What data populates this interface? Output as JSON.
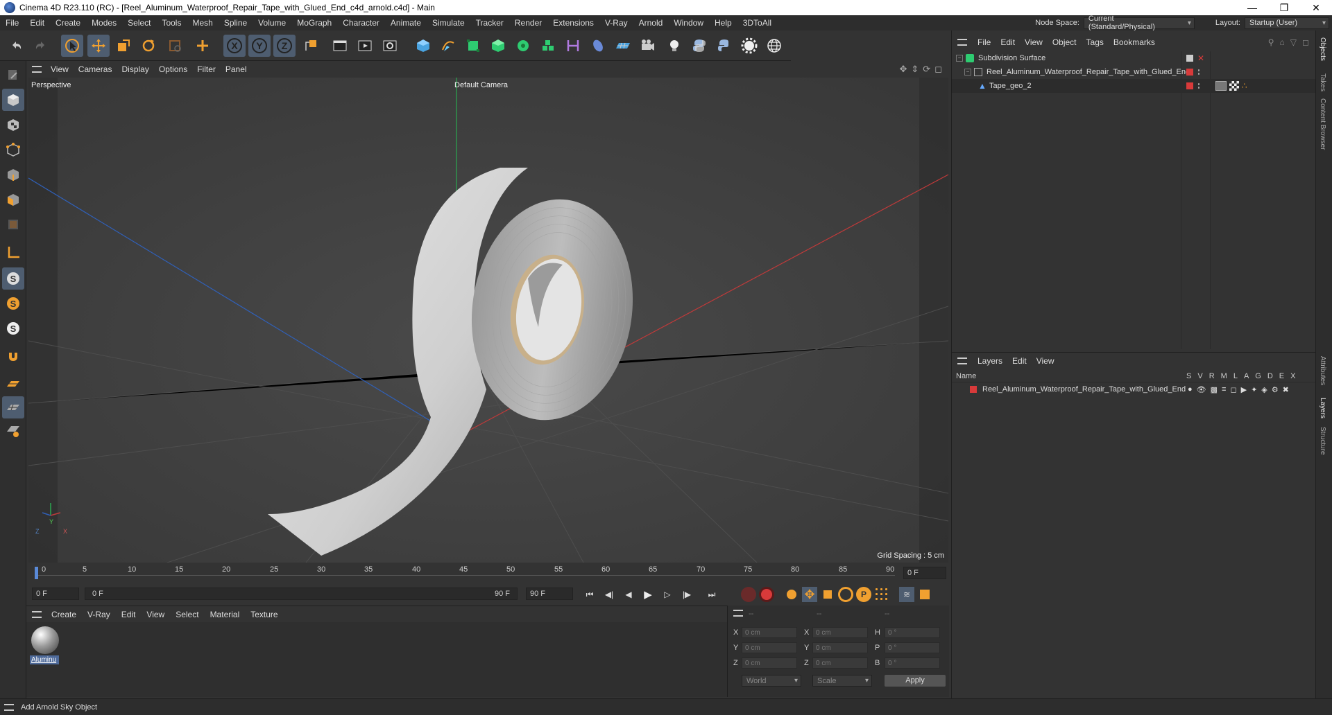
{
  "window": {
    "title": "Cinema 4D R23.110 (RC) - [Reel_Aluminum_Waterproof_Repair_Tape_with_Glued_End_c4d_arnold.c4d] - Main"
  },
  "menubar": {
    "items": [
      "File",
      "Edit",
      "Create",
      "Modes",
      "Select",
      "Tools",
      "Mesh",
      "Spline",
      "Volume",
      "MoGraph",
      "Character",
      "Animate",
      "Simulate",
      "Tracker",
      "Render",
      "Extensions",
      "V-Ray",
      "Arnold",
      "Window",
      "Help",
      "3DToAll"
    ],
    "node_space_label": "Node Space:",
    "node_space_value": "Current (Standard/Physical)",
    "layout_label": "Layout:",
    "layout_value": "Startup (User)"
  },
  "viewport": {
    "menu": [
      "View",
      "Cameras",
      "Display",
      "Options",
      "Filter",
      "Panel"
    ],
    "view_name": "Perspective",
    "camera": "Default Camera",
    "grid_spacing": "Grid Spacing : 5 cm",
    "axis_labels": {
      "y": "Y",
      "z": "Z",
      "x": "X"
    }
  },
  "timeline": {
    "ticks": [
      "0",
      "5",
      "10",
      "15",
      "20",
      "25",
      "30",
      "35",
      "40",
      "45",
      "50",
      "55",
      "60",
      "65",
      "70",
      "75",
      "80",
      "85",
      "90"
    ],
    "current_frame": "0 F"
  },
  "playbar": {
    "start": "0 F",
    "range_start": "0 F",
    "range_end": "90 F",
    "end": "90 F"
  },
  "materials": {
    "menu": [
      "Create",
      "V-Ray",
      "Edit",
      "View",
      "Select",
      "Material",
      "Texture"
    ],
    "items": [
      {
        "label": "Aluminu"
      }
    ]
  },
  "coordinates": {
    "header": [
      "--",
      "--",
      "--"
    ],
    "rows": [
      {
        "a": "X",
        "av": "0 cm",
        "b": "X",
        "bv": "0 cm",
        "c": "H",
        "cv": "0 °"
      },
      {
        "a": "Y",
        "av": "0 cm",
        "b": "Y",
        "bv": "0 cm",
        "c": "P",
        "cv": "0 °"
      },
      {
        "a": "Z",
        "av": "0 cm",
        "b": "Z",
        "bv": "0 cm",
        "c": "B",
        "cv": "0 °"
      }
    ],
    "world": "World",
    "scale": "Scale",
    "apply": "Apply"
  },
  "objects": {
    "menu": [
      "File",
      "Edit",
      "View",
      "Object",
      "Tags",
      "Bookmarks"
    ],
    "rows": [
      {
        "name": "Subdivision Surface"
      },
      {
        "name": "Reel_Aluminum_Waterproof_Repair_Tape_with_Glued_End"
      },
      {
        "name": "Tape_geo_2"
      }
    ]
  },
  "layers": {
    "menu": [
      "Layers",
      "Edit",
      "View"
    ],
    "header_name": "Name",
    "flags": [
      "S",
      "V",
      "R",
      "M",
      "L",
      "A",
      "G",
      "D",
      "E",
      "X"
    ],
    "rows": [
      {
        "name": "Reel_Aluminum_Waterproof_Repair_Tape_with_Glued_End"
      }
    ]
  },
  "side_tabs": [
    "Objects",
    "Takes",
    "Content Browser",
    "Attributes",
    "Layers",
    "Structure"
  ],
  "status": {
    "text": "Add Arnold Sky Object"
  }
}
